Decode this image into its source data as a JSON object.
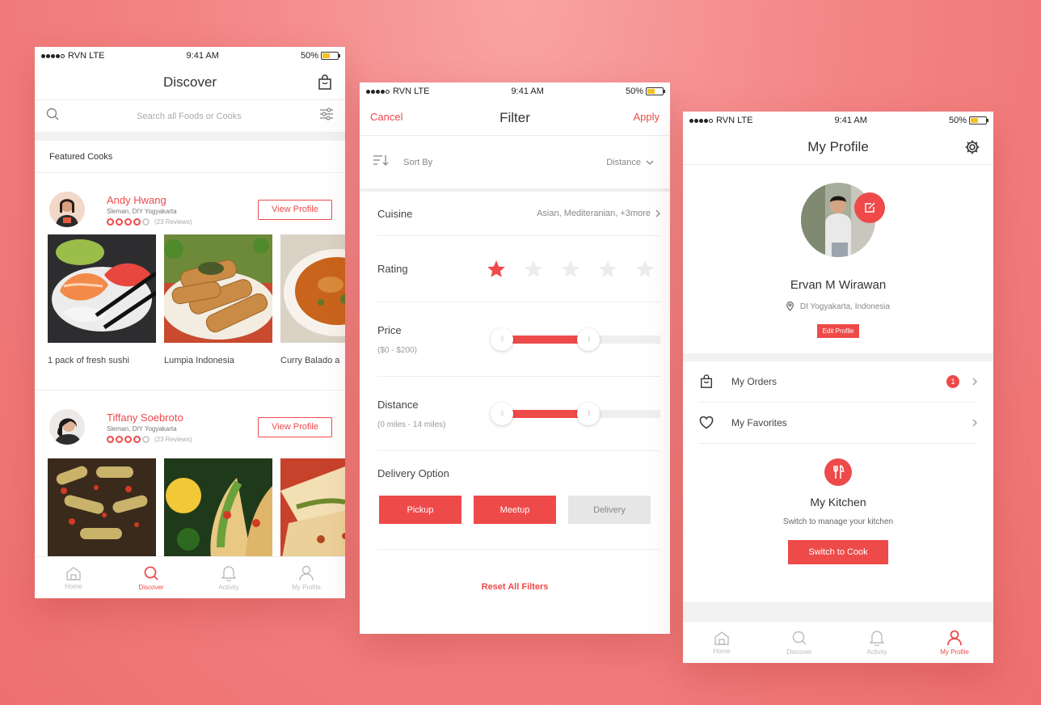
{
  "status_bar": {
    "carrier": "RVN LTE",
    "time": "9:41 AM",
    "battery": "50%"
  },
  "discover": {
    "title": "Discover",
    "search_placeholder": "Search all Foods or Cooks",
    "section_label": "Featured Cooks",
    "cooks": [
      {
        "name": "Andy Hwang",
        "location": "Sleman, DIY Yogyakarta",
        "rating_of_5": 4,
        "reviews": "(23 Reviews)",
        "button": "View Profile",
        "foods": [
          "1 pack of fresh sushi",
          "Lumpia Indonesia",
          "Curry Balado a"
        ]
      },
      {
        "name": "Tiffany Soebroto",
        "location": "Sleman, DIY Yogyakarta",
        "rating_of_5": 4,
        "reviews": "(23 Reviews)",
        "button": "View Profile"
      }
    ],
    "tabs": [
      {
        "label": "Home",
        "icon": "home-icon"
      },
      {
        "label": "Discover",
        "icon": "search-icon",
        "active": true
      },
      {
        "label": "Activity",
        "icon": "bell-icon"
      },
      {
        "label": "My Profile",
        "icon": "person-icon"
      }
    ]
  },
  "filter": {
    "title": "Filter",
    "cancel": "Cancel",
    "apply": "Apply",
    "sort_label": "Sort By",
    "sort_value": "Distance",
    "cuisine_label": "Cuisine",
    "cuisine_value": "Asian, Mediteranian, +3more",
    "rating_label": "Rating",
    "rating_selected_of_5": 1,
    "price_label": "Price",
    "price_range": "($0 - $200)",
    "price_slider": {
      "low": 0,
      "high": 0.59
    },
    "distance_label": "Distance",
    "distance_range": "(0 miles - 14 miles)",
    "distance_slider": {
      "low": 0,
      "high": 0.59
    },
    "delivery_label": "Delivery Option",
    "delivery_options": [
      {
        "label": "Pickup",
        "selected": true
      },
      {
        "label": "Meetup",
        "selected": true
      },
      {
        "label": "Delivery",
        "selected": false
      }
    ],
    "reset": "Reset All Filters"
  },
  "profile": {
    "title": "My Profile",
    "name": "Ervan M Wirawan",
    "location": "DI Yogyakarta, Indonesia",
    "edit_button": "Edit Profile",
    "menu": [
      {
        "label": "My Orders",
        "icon": "bag-icon",
        "badge": "1"
      },
      {
        "label": "My Favorites",
        "icon": "heart-icon"
      }
    ],
    "kitchen_title": "My Kitchen",
    "kitchen_sub": "Switch to manage your kitchen",
    "kitchen_button": "Switch to Cook",
    "tabs": [
      {
        "label": "Home",
        "icon": "home-icon"
      },
      {
        "label": "Discover",
        "icon": "search-icon"
      },
      {
        "label": "Activity",
        "icon": "bell-icon"
      },
      {
        "label": "My Profile",
        "icon": "person-icon",
        "active": true
      }
    ]
  },
  "colors": {
    "accent": "#ee4a4a",
    "background": "#f38484",
    "battery": "#f5c11a"
  }
}
